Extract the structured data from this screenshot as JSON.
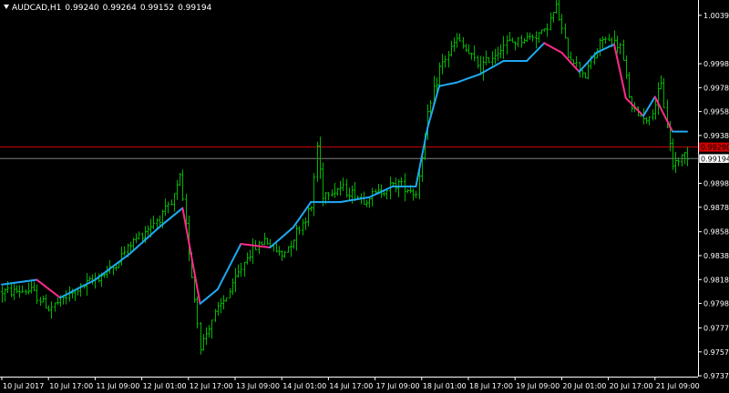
{
  "header": {
    "symbol": "AUDCAD,H1",
    "open": "0.99240",
    "high": "0.99264",
    "low": "0.99152",
    "close": "0.99194"
  },
  "price_labels": {
    "bid_line_value": "0.99194",
    "red_line_value": "0.99290"
  },
  "colors": {
    "background": "#000000",
    "bars": "#00b400",
    "ma_up": "#1fa8f0",
    "ma_down": "#ff2a8a",
    "red_line": "#d00000",
    "bid_line": "#808080",
    "axis": "#ffffff"
  },
  "chart_data": {
    "type": "ohlc",
    "ylim": [
      0.9737,
      1.0052
    ],
    "y_ticks": [
      "1.00392",
      "0.99987",
      "0.99787",
      "0.99587",
      "0.99387",
      "0.99187",
      "0.98987",
      "0.98787",
      "0.98582",
      "0.98382",
      "0.98182",
      "0.97982",
      "0.97777",
      "0.97577",
      "0.97377"
    ],
    "x_tick_labels": [
      "10 Jul 2017",
      "10 Jul 17:00",
      "11 Jul 09:00",
      "12 Jul 01:00",
      "12 Jul 17:00",
      "13 Jul 09:00",
      "14 Jul 01:00",
      "14 Jul 17:00",
      "17 Jul 09:00",
      "18 Jul 01:00",
      "18 Jul 17:00",
      "19 Jul 09:00",
      "20 Jul 01:00",
      "20 Jul 17:00",
      "21 Jul 09:00"
    ],
    "x_ticks_bar_index": [
      0,
      16,
      32,
      48,
      64,
      80,
      96,
      112,
      128,
      144,
      160,
      176,
      192,
      208,
      224
    ],
    "red_line_price": 0.9929,
    "bid_line_price": 0.99194,
    "price_path": [
      [
        0,
        0.9808
      ],
      [
        10,
        0.9809
      ],
      [
        16,
        0.9794
      ],
      [
        28,
        0.9813
      ],
      [
        38,
        0.9828
      ],
      [
        44,
        0.9848
      ],
      [
        52,
        0.9866
      ],
      [
        58,
        0.988
      ],
      [
        61,
        0.9903
      ],
      [
        62,
        0.9883
      ],
      [
        68,
        0.9762
      ],
      [
        72,
        0.9785
      ],
      [
        78,
        0.9808
      ],
      [
        84,
        0.9838
      ],
      [
        90,
        0.9852
      ],
      [
        96,
        0.9838
      ],
      [
        102,
        0.9862
      ],
      [
        106,
        0.9878
      ],
      [
        108,
        0.993
      ],
      [
        110,
        0.989
      ],
      [
        116,
        0.9895
      ],
      [
        124,
        0.9885
      ],
      [
        132,
        0.9895
      ],
      [
        136,
        0.9899
      ],
      [
        142,
        0.989
      ],
      [
        146,
        0.9955
      ],
      [
        150,
        0.9995
      ],
      [
        156,
        1.0019
      ],
      [
        164,
        0.9995
      ],
      [
        172,
        1.0015
      ],
      [
        180,
        1.002
      ],
      [
        186,
        1.0026
      ],
      [
        190,
        1.0046
      ],
      [
        194,
        1.0007
      ],
      [
        200,
        0.9989
      ],
      [
        206,
        1.002
      ],
      [
        212,
        1.0013
      ],
      [
        216,
        0.996
      ],
      [
        222,
        0.9952
      ],
      [
        226,
        0.998
      ],
      [
        230,
        0.9915
      ],
      [
        234,
        0.9923
      ]
    ],
    "ma_path": [
      [
        0,
        0.9814
      ],
      [
        12,
        0.9818
      ],
      [
        20,
        0.9803
      ],
      [
        32,
        0.9818
      ],
      [
        44,
        0.984
      ],
      [
        54,
        0.9862
      ],
      [
        62,
        0.9878
      ],
      [
        68,
        0.9798
      ],
      [
        74,
        0.981
      ],
      [
        82,
        0.9848
      ],
      [
        92,
        0.9845
      ],
      [
        100,
        0.9862
      ],
      [
        106,
        0.9883
      ],
      [
        116,
        0.9883
      ],
      [
        126,
        0.9887
      ],
      [
        134,
        0.9896
      ],
      [
        142,
        0.9896
      ],
      [
        146,
        0.9945
      ],
      [
        150,
        0.998
      ],
      [
        156,
        0.9983
      ],
      [
        164,
        0.999
      ],
      [
        172,
        1.0001
      ],
      [
        180,
        1.0001
      ],
      [
        186,
        1.0016
      ],
      [
        192,
        1.0008
      ],
      [
        198,
        0.9992
      ],
      [
        204,
        1.0008
      ],
      [
        210,
        1.0015
      ],
      [
        214,
        0.997
      ],
      [
        220,
        0.9955
      ],
      [
        224,
        0.9971
      ],
      [
        230,
        0.9942
      ]
    ]
  }
}
